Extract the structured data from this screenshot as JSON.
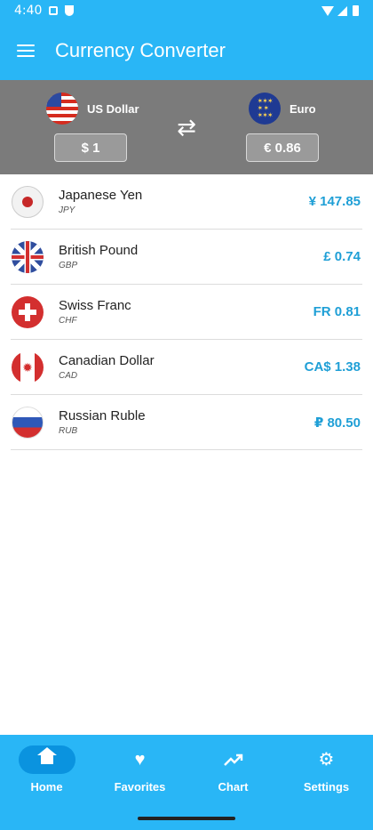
{
  "status_bar": {
    "time": "4:40"
  },
  "app_bar": {
    "title": "Currency Converter",
    "menu_icon": "hamburger-menu-icon"
  },
  "converter": {
    "from": {
      "name": "US Dollar",
      "flag": "us-flag-icon",
      "value": "$ 1"
    },
    "to": {
      "name": "Euro",
      "flag": "eu-flag-icon",
      "value": "€ 0.86"
    },
    "swap_icon": "swap-arrows-icon"
  },
  "currencies": [
    {
      "name": "Japanese Yen",
      "code": "JPY",
      "value": "¥ 147.85",
      "flag": "jp-flag-icon"
    },
    {
      "name": "British Pound",
      "code": "GBP",
      "value": "£ 0.74",
      "flag": "gb-flag-icon"
    },
    {
      "name": "Swiss Franc",
      "code": "CHF",
      "value": "FR 0.81",
      "flag": "ch-flag-icon"
    },
    {
      "name": "Canadian Dollar",
      "code": "CAD",
      "value": "CA$ 1.38",
      "flag": "ca-flag-icon"
    },
    {
      "name": "Russian Ruble",
      "code": "RUB",
      "value": "₽ 80.50",
      "flag": "ru-flag-icon"
    }
  ],
  "bottom_nav": {
    "items": [
      {
        "label": "Home",
        "icon": "home-icon",
        "active": true
      },
      {
        "label": "Favorites",
        "icon": "heart-icon",
        "active": false
      },
      {
        "label": "Chart",
        "icon": "trending-up-icon",
        "active": false
      },
      {
        "label": "Settings",
        "icon": "gear-icon",
        "active": false
      }
    ]
  },
  "colors": {
    "primary": "#29b6f6",
    "converter_bg": "#7b7b7b",
    "value_text": "#1f9fd6",
    "active_pill": "#0a93df"
  }
}
